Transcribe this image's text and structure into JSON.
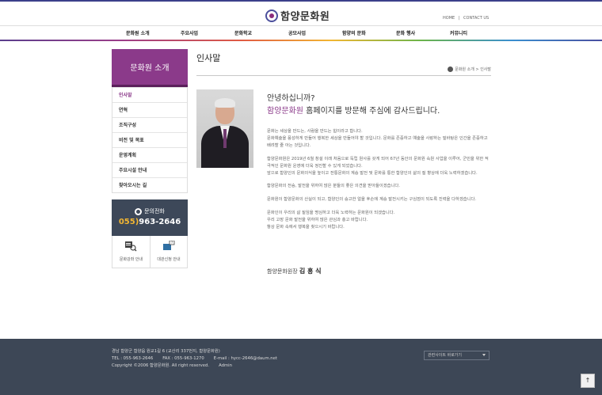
{
  "header": {
    "site_name": "함양문화원",
    "top_links": [
      "HOME",
      "|",
      "CONTACT US"
    ]
  },
  "gnb": {
    "items": [
      "문화원 소개",
      "주요사업",
      "문화학교",
      "공모사업",
      "함양의 문화",
      "문화 행사",
      "커뮤니티"
    ]
  },
  "lnb": {
    "title": "문화원 소개",
    "items": [
      "인사말",
      "연혁",
      "조직구성",
      "비전 및 목표",
      "운영계획",
      "주요시설 안내",
      "찾아오시는 길"
    ],
    "active_index": 0
  },
  "call": {
    "title": "문의전화",
    "area": "055)",
    "number": "963-2646"
  },
  "quick": {
    "items": [
      "문화강좌 안내",
      "대관신청 안내"
    ]
  },
  "main": {
    "page_title": "인사말",
    "location": "문화원 소개 > 인사말",
    "greeting1": "안녕하십니까?",
    "greeting2_highlight": "함양문화원",
    "greeting2_rest": " 홈페이지를 방문해 주심에 감사드립니다.",
    "paragraphs": [
      "문화는 세상을 만드는, 사람을 만드는 힘이라고 합니다.\n문화예술을 풍성하게 만들어 행복한 세상을 만들어야 할 것입니다. 문화를 존중하고 예술을 사랑하는 밑바탕은 인간을 존중하고 배려할 줄 아는 것입니다.",
      "함양문화원은 2019년 6월 창설 이래 처음으로 독립 원사를 갖게 되어 67년 동안의 문화원 숙원 사업을 이루어, 군민을 위한 적극적인 문화원 운영에 더욱 정진할 수 있게 되었습니다.\n앞으로 함양인의 문화의식을 높이고 전통문화의 계승 발전 및 문화를 통한 함양인의 삶의 질 향상에 더욱 노력하겠습니다.",
      "함양문화의 전승, 발전을 위하여 많은 분들의 좋은 의견을 받아들이겠습니다.",
      "문화원이 함양문화의 산실이 되고, 함양인의 숭고한 얼을 후손에 계승 발전시키는 구심점이 되도록 진력을 다하겠습니다.",
      "문화인이 우리의 삶 질임을 명심하고 더욱 노력하는 문화원이 되겠습니다.\n우리 고장 문화 발전을 위하여 많은 관심과 충고 바랍니다.\n항상 문화 속에서 행복을 찾으시기 바랍니다."
    ],
    "sign_prefix": "함양문화원장 ",
    "sign_name": "김 흥 식"
  },
  "footer": {
    "address": "경남 함양군 함양읍 원교1길 6 (교산리 337번지, 함양문화원)",
    "tel": "TEL : 055-963-2646",
    "fax": "FAX : 055-963-1270",
    "email": "E-mail : hycc-2646@daum.net",
    "copyright": "Copyright ©2006 함양문화원. All right reserved.",
    "admin": "Admin",
    "select_label": "관련사이트 바로가기"
  },
  "totop_label": "↑",
  "colors": {
    "accent": "#8b3a8a",
    "footer_bg": "#3d4756",
    "call_bg": "#3d4859"
  }
}
